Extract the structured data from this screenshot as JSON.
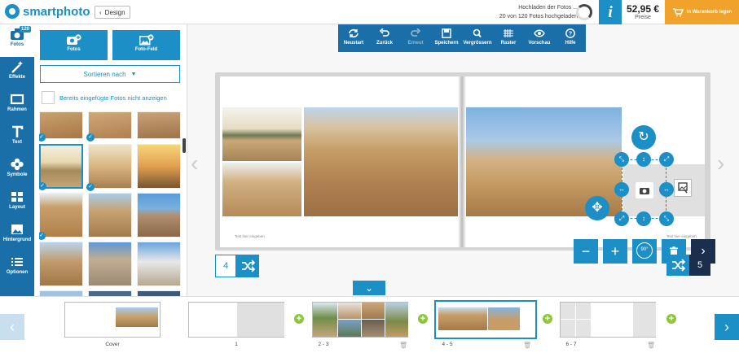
{
  "brand": {
    "name": "smartphoto"
  },
  "header": {
    "back_label": "Design",
    "upload_line1": "Hochladen der Fotos ...",
    "upload_line2": "20 von 120 Fotos hochgeladen",
    "info_icon": "i",
    "price": "52,95 €",
    "price_label": "Preise",
    "cart_label": "In Warenkorb legen"
  },
  "leftnav": {
    "badge": "120",
    "items": [
      {
        "label": "Fotos",
        "icon": "camera-icon"
      },
      {
        "label": "Effekte",
        "icon": "magic-wand-icon"
      },
      {
        "label": "Rahmen",
        "icon": "frame-icon"
      },
      {
        "label": "Text",
        "icon": "text-icon"
      },
      {
        "label": "Symbole",
        "icon": "flower-icon"
      },
      {
        "label": "Layout",
        "icon": "layout-icon"
      },
      {
        "label": "Hintergrund",
        "icon": "image-icon"
      },
      {
        "label": "Optionen",
        "icon": "list-icon"
      }
    ]
  },
  "panel": {
    "btn_photos": "Fotos",
    "btn_photofield": "Foto-Feld",
    "sort_label": "Sortieren nach",
    "hide_label": "Bereits eingefügte Fotos nicht anzeigen"
  },
  "toolbar": [
    {
      "label": "Neustart",
      "icon": "refresh-icon"
    },
    {
      "label": "Zurück",
      "icon": "undo-icon"
    },
    {
      "label": "Erneut",
      "icon": "redo-icon"
    },
    {
      "label": "Speichern",
      "icon": "save-icon"
    },
    {
      "label": "Vergrössern",
      "icon": "zoom-icon"
    },
    {
      "label": "Raster",
      "icon": "grid-icon"
    },
    {
      "label": "Vorschau",
      "icon": "eye-icon"
    },
    {
      "label": "Hilfe",
      "icon": "help-icon"
    }
  ],
  "canvas": {
    "caption_left": "Text hier eingeben",
    "caption_right": "Text hier eingeben",
    "page_left_num": "4",
    "page_right_num": "5"
  },
  "zoom": {
    "minus": "−",
    "plus": "+",
    "rotate_label": "90°"
  },
  "filmstrip": [
    {
      "label": "Cover"
    },
    {
      "label": "1"
    },
    {
      "label": "2 - 3"
    },
    {
      "label": "4 - 5"
    },
    {
      "label": "6 - 7"
    }
  ],
  "colors": {
    "primary": "#1b8fc6",
    "nav": "#1b6fa8",
    "accent": "#f0a22b",
    "add": "#8cc63f",
    "dark": "#1a2f4d"
  }
}
